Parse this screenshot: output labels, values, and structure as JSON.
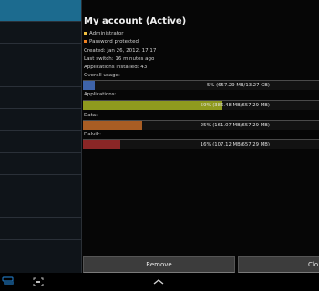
{
  "account": {
    "title": "My account (Active)",
    "roles": [
      {
        "label": "Administrator",
        "color": "#f0c040"
      },
      {
        "label": "Password protected",
        "color": "#f08020"
      }
    ],
    "created": "Created: Jan 26, 2012, 17:17",
    "last_switch": "Last switch: 16 minutes ago",
    "apps_installed": "Applications installed: 43"
  },
  "usage": [
    {
      "label": "Overall usage:",
      "text": "5% (657.29 MB/13.27 GB)",
      "percent": 5,
      "color": "#3e63a8"
    },
    {
      "label": "Applications:",
      "text": "59% (386.48 MB/657.29 MB)",
      "percent": 59,
      "color": "#8f9a1e"
    },
    {
      "label": "Data:",
      "text": "25% (161.07 MB/657.29 MB)",
      "percent": 25,
      "color": "#a85d24"
    },
    {
      "label": "Dalvik:",
      "text": "16% (107.12 MB/657.29 MB)",
      "percent": 16,
      "color": "#8a2626"
    }
  ],
  "buttons": {
    "remove": "Remove",
    "clone": "Clo"
  },
  "colors": {
    "selected_row": "#1c6b8f",
    "background": "#000000"
  },
  "nav_icons": [
    "recent-apps-icon",
    "screenshot-icon",
    "home-chevron-icon"
  ]
}
